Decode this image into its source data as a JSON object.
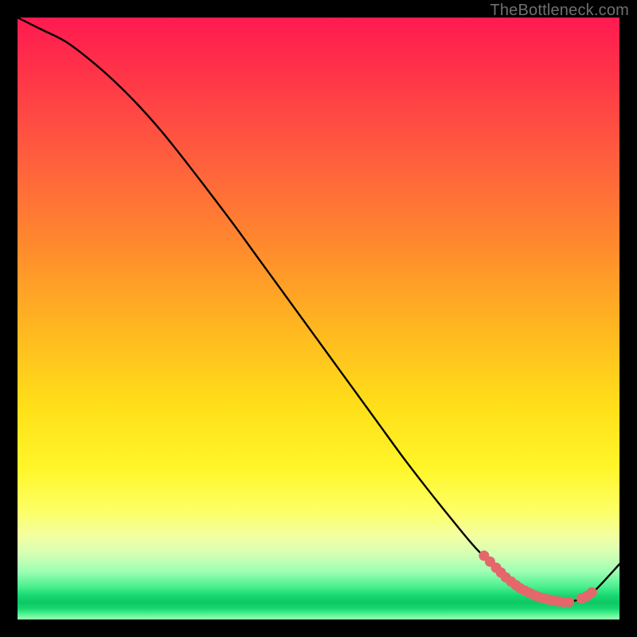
{
  "attribution": "TheBottleneck.com",
  "chart_data": {
    "type": "line",
    "title": "",
    "xlabel": "",
    "ylabel": "",
    "xlim": [
      0,
      100
    ],
    "ylim": [
      0,
      100
    ],
    "grid": false,
    "legend": false,
    "series": [
      {
        "name": "curve",
        "x": [
          0,
          4,
          8,
          12,
          16,
          20,
          24,
          28,
          32,
          36,
          40,
          44,
          48,
          52,
          56,
          60,
          64,
          68,
          72,
          76,
          80,
          82,
          84,
          86,
          88,
          90,
          92,
          94,
          96,
          100
        ],
        "values": [
          100,
          98,
          96,
          93,
          89.5,
          85.5,
          81,
          76,
          70.8,
          65.5,
          60,
          54.5,
          49,
          43.5,
          38,
          32.5,
          27,
          21.8,
          16.8,
          12,
          8,
          6.3,
          4.9,
          3.9,
          3.2,
          2.9,
          3.0,
          3.6,
          4.9,
          9.2
        ]
      }
    ],
    "markers": {
      "name": "highlight-dots",
      "color": "#e4676b",
      "x": [
        77.5,
        78.5,
        79.5,
        80.3,
        81.1,
        82.0,
        82.8,
        83.5,
        84.3,
        85.1,
        85.9,
        86.7,
        87.5,
        88.3,
        89.1,
        89.9,
        90.7,
        91.6,
        93.7,
        94.6,
        95.4
      ],
      "values": [
        10.6,
        9.6,
        8.6,
        7.8,
        7.0,
        6.3,
        5.7,
        5.2,
        4.8,
        4.4,
        4.0,
        3.7,
        3.5,
        3.3,
        3.1,
        3.0,
        2.9,
        2.9,
        3.5,
        3.9,
        4.5
      ]
    },
    "gradient_bands": [
      {
        "color": "#ff1a50",
        "stop_pct": 0
      },
      {
        "color": "#ff8a2d",
        "stop_pct": 38
      },
      {
        "color": "#fff62a",
        "stop_pct": 75
      },
      {
        "color": "#18d872",
        "stop_pct": 96
      }
    ]
  }
}
